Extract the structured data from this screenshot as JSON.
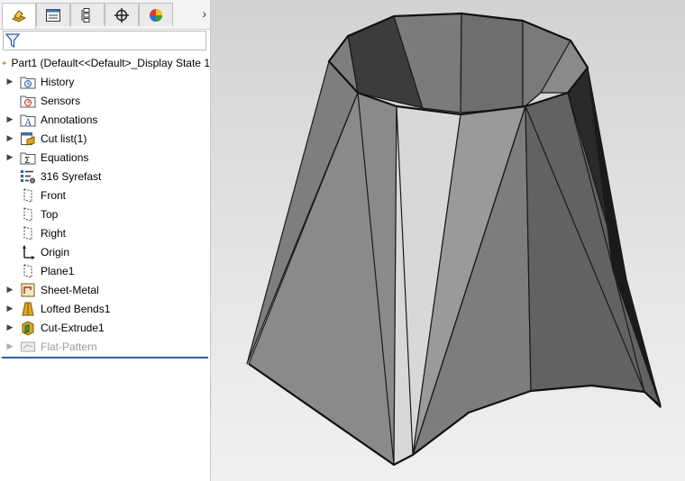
{
  "tabs": [
    {
      "name": "feature-manager",
      "icon": "feature-manager-icon",
      "active": true
    },
    {
      "name": "property-manager",
      "icon": "property-manager-icon",
      "active": false
    },
    {
      "name": "configuration-manager",
      "icon": "configuration-manager-icon",
      "active": false
    },
    {
      "name": "dimxpert-manager",
      "icon": "dimxpert-icon",
      "active": false
    },
    {
      "name": "display-manager",
      "icon": "display-manager-icon",
      "active": false
    }
  ],
  "tree": {
    "root_label": "Part1  (Default<<Default>_Display State 1",
    "items": [
      {
        "label": "History",
        "icon": "history-folder-icon",
        "expandable": true
      },
      {
        "label": "Sensors",
        "icon": "sensors-folder-icon",
        "expandable": false
      },
      {
        "label": "Annotations",
        "icon": "annotations-folder-icon",
        "expandable": true
      },
      {
        "label": "Cut list(1)",
        "icon": "cut-list-icon",
        "expandable": true
      },
      {
        "label": "Equations",
        "icon": "equations-folder-icon",
        "expandable": true
      },
      {
        "label": "316 Syrefast",
        "icon": "material-icon",
        "expandable": false
      },
      {
        "label": "Front",
        "icon": "plane-icon",
        "expandable": false
      },
      {
        "label": "Top",
        "icon": "plane-icon",
        "expandable": false
      },
      {
        "label": "Right",
        "icon": "plane-icon",
        "expandable": false
      },
      {
        "label": "Origin",
        "icon": "origin-icon",
        "expandable": false
      },
      {
        "label": "Plane1",
        "icon": "plane-icon",
        "expandable": false
      },
      {
        "label": "Sheet-Metal",
        "icon": "sheet-metal-icon",
        "expandable": true
      },
      {
        "label": "Lofted Bends1",
        "icon": "lofted-bends-icon",
        "expandable": true
      },
      {
        "label": "Cut-Extrude1",
        "icon": "cut-extrude-icon",
        "expandable": true
      },
      {
        "label": "Flat-Pattern",
        "icon": "flat-pattern-icon",
        "expandable": true,
        "suppressed": true
      }
    ]
  },
  "colors": {
    "rollback_bar": "#2f5fa8",
    "suppressed_text": "#9a9a9a"
  }
}
